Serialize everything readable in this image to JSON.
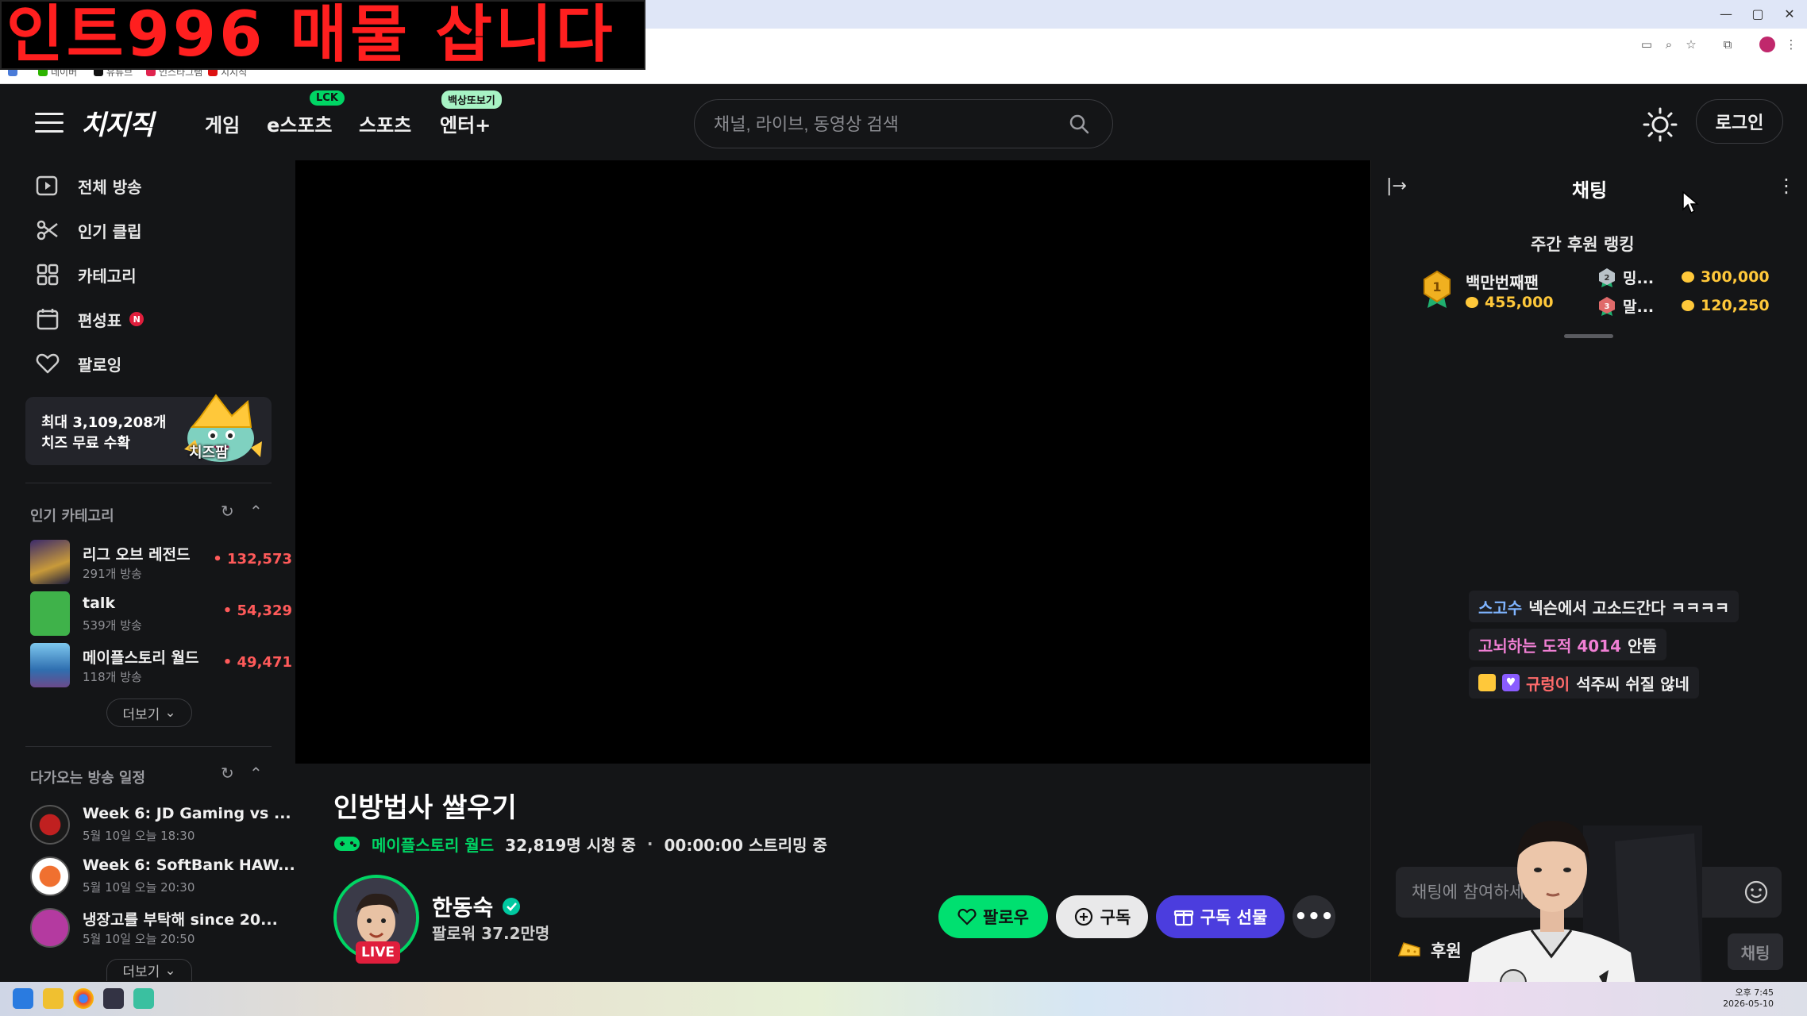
{
  "overlay": {
    "text": "인트996 매물 삽니다"
  },
  "browser": {
    "window_controls": {
      "minimize": "—",
      "maximize": "▢",
      "close": "✕"
    },
    "bookmarks": [
      "앱",
      "네이버",
      "유튜브",
      "인스타그램",
      "치지직"
    ],
    "colors": {
      "top": "#dfe6f7"
    }
  },
  "header": {
    "logo": "치지직",
    "nav": [
      {
        "label": "게임"
      },
      {
        "label": "e스포츠",
        "badge": "LCK"
      },
      {
        "label": "스포츠"
      },
      {
        "label": "엔터+",
        "badge": "백상또보기"
      }
    ],
    "search": {
      "placeholder": "채널, 라이브, 동영상 검색"
    },
    "login_label": "로그인"
  },
  "sidebar": {
    "items": [
      {
        "label": "전체 방송",
        "icon": "play-box-icon"
      },
      {
        "label": "인기 클립",
        "icon": "scissors-icon"
      },
      {
        "label": "카테고리",
        "icon": "grid-icon"
      },
      {
        "label": "편성표",
        "icon": "calendar-icon",
        "badge": "N"
      },
      {
        "label": "팔로잉",
        "icon": "heart-icon"
      }
    ],
    "promo": {
      "line1": "최대 3,109,208개",
      "line2": "치즈 무료 수확",
      "tag": "치즈팜"
    },
    "popular_categories": {
      "title": "인기 카테고리",
      "items": [
        {
          "name": "리그 오브 레전드",
          "sub": "291개 방송",
          "count": "132,573"
        },
        {
          "name": "talk",
          "sub": "539개 방송",
          "count": "54,329"
        },
        {
          "name": "메이플스토리 월드",
          "sub": "118개 방송",
          "count": "49,471"
        }
      ],
      "more_label": "더보기"
    },
    "schedule": {
      "title": "다가오는 방송 일정",
      "items": [
        {
          "title": "Week 6: JD Gaming vs ...",
          "time": "5월 10일 오늘 18:30"
        },
        {
          "title": "Week 6: SoftBank HAW...",
          "time": "5월 10일 오늘 20:30"
        },
        {
          "title": "냉장고를 부탁해 since 20...",
          "time": "5월 10일 오늘 20:50"
        }
      ],
      "more_label": "더보기"
    }
  },
  "stream": {
    "title": "인방법사 쌀우기",
    "category": "메이플스토리 월드",
    "viewers": "32,819명 시청 중",
    "separator": "·",
    "uptime": "00:00:00 스트리밍 중",
    "live_label": "LIVE",
    "streamer_name": "한동숙",
    "followers": "팔로워 37.2만명",
    "buttons": {
      "follow": "팔로우",
      "subscribe": "구독",
      "gift": "구독 선물",
      "more": "•••"
    }
  },
  "chat": {
    "title": "채팅",
    "collapse": "|→",
    "menu": "⋮",
    "ranking": {
      "title": "주간 후원 랭킹",
      "first": {
        "name": "백만번째팬",
        "amount": "455,000"
      },
      "second": {
        "name": "밍...",
        "amount": "300,000"
      },
      "third": {
        "name": "말...",
        "amount": "120,250"
      }
    },
    "messages": [
      {
        "user": "스고수",
        "text": "넥슨에서 고소드간다 ㅋㅋㅋㅋ",
        "color": "#7fb4ff"
      },
      {
        "user": "고뇌하는 도적 4014",
        "text": "안뜸",
        "color": "#f07fd4"
      },
      {
        "user": "규렁이",
        "text": "석주씨 쉬질 않네",
        "color": "#ff6b6b"
      }
    ],
    "input_placeholder": "채팅에 참여하세요",
    "donate_label": "후원",
    "send_label": "채팅"
  },
  "taskbar": {
    "time": "오후 7:45",
    "date": "2026-05-10"
  }
}
